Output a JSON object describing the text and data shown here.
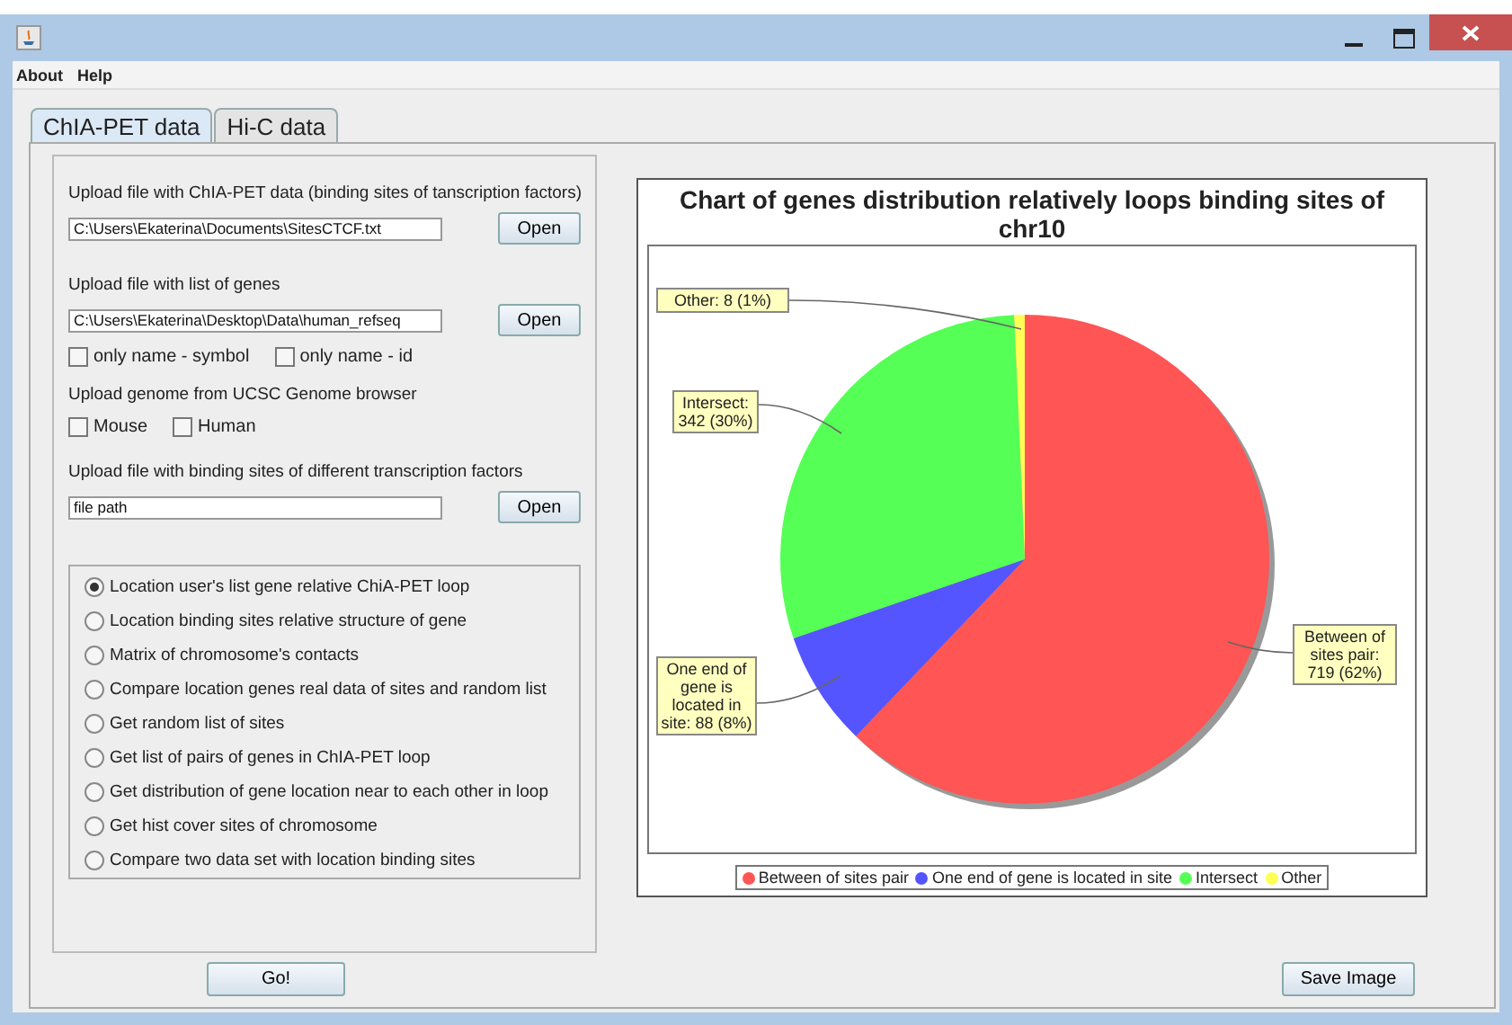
{
  "menu": [
    "About",
    "Help"
  ],
  "tabs": [
    {
      "label": "ChIA-PET data",
      "selected": true
    },
    {
      "label": "Hi-C data",
      "selected": false
    }
  ],
  "chia_file": {
    "label": "Upload file with ChIA-PET data (binding sites of tanscription factors)",
    "value": "C:\\Users\\Ekaterina\\Documents\\SitesCTCF.txt",
    "button": "Open"
  },
  "genes_file": {
    "label": "Upload file with list of genes",
    "value": "C:\\Users\\Ekaterina\\Desktop\\Data\\human_refseq",
    "button": "Open",
    "options": [
      {
        "label": "only name - symbol",
        "checked": false
      },
      {
        "label": "only name - id",
        "checked": false
      }
    ]
  },
  "genome": {
    "label": "Upload genome from UCSC Genome browser",
    "options": [
      {
        "label": "Mouse",
        "checked": false
      },
      {
        "label": "Human",
        "checked": false
      }
    ]
  },
  "factors_file": {
    "label": "Upload file with binding sites of different transcription factors",
    "value": "file path",
    "button": "Open"
  },
  "analyses": [
    {
      "label": "Location user's list gene relative ChiA-PET loop",
      "selected": true
    },
    {
      "label": "Location binding sites relative structure of gene",
      "selected": false
    },
    {
      "label": "Matrix of chromosome's contacts",
      "selected": false
    },
    {
      "label": "Compare location genes real data of sites and random list",
      "selected": false
    },
    {
      "label": "Get random list of sites",
      "selected": false
    },
    {
      "label": "Get list of pairs of genes in ChIA-PET loop",
      "selected": false
    },
    {
      "label": "Get distribution of gene location near to each other in loop",
      "selected": false
    },
    {
      "label": "Get hist cover sites of chromosome",
      "selected": false
    },
    {
      "label": "Compare two data set with location binding sites",
      "selected": false
    }
  ],
  "go_button": "Go!",
  "chart": {
    "chart_data": {
      "type": "pie",
      "title": "Chart of genes distribution relatively loops binding sites of chr10",
      "categories": [
        "Between of sites pair",
        "One end of gene is located in site",
        "Intersect",
        "Other"
      ],
      "values": [
        62.14,
        7.61,
        29.56,
        0.69
      ],
      "colors": [
        "#ff5555",
        "#5555ff",
        "#55ff55",
        "#ffff55"
      ],
      "legend": true,
      "annotations": [
        "Between of sites pair: 719 (62%)",
        "One end of gene is located in site: 88 (8%)",
        "Intersect: 342 (30%)",
        "Other: 8 (1%)"
      ]
    }
  },
  "save_button": "Save Image"
}
